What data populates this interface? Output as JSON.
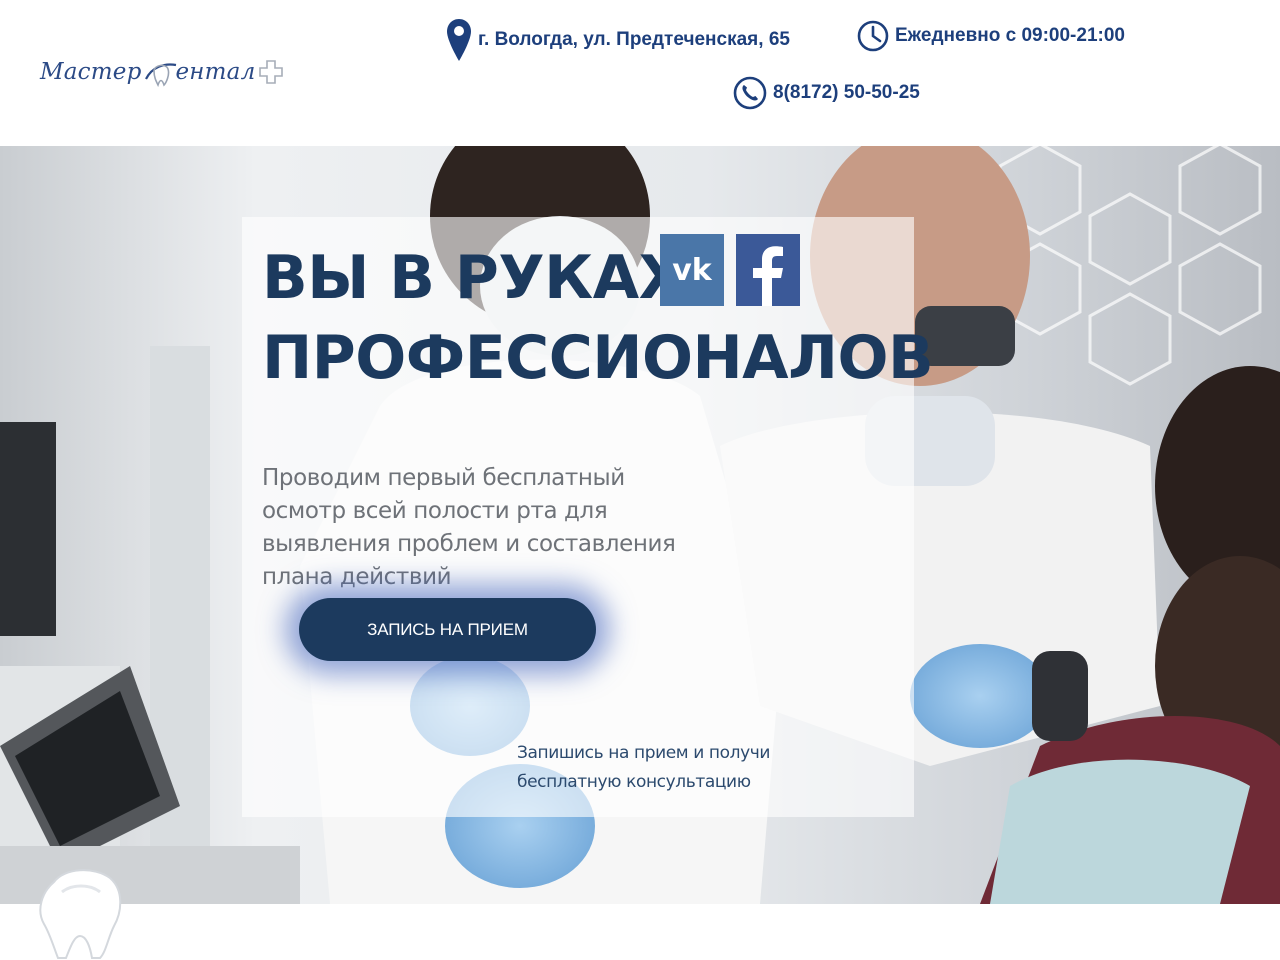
{
  "header": {
    "logo": {
      "word1": "Мастер",
      "word2": "ентал"
    },
    "address": "г. Вологда, ул. Предтеченская, 65",
    "hours": "Ежедневно с 09:00-21:00",
    "phone": "8(8172) 50-50-25",
    "icons": {
      "address": "map-pin-icon",
      "hours": "clock-icon",
      "phone": "phone-icon"
    }
  },
  "hero": {
    "title_line1": "ВЫ В РУКАХ",
    "title_line2": "ПРОФЕССИОНАЛОВ",
    "subtitle": "Проводим первый бесплатный осмотр всей полости рта для выявления проблем и составления плана действий",
    "cta_label": "ЗАПИСЬ НА ПРИЕМ",
    "note": "Запишись на прием и получи бесплатную консультацию",
    "social": [
      "vk-icon",
      "facebook-icon"
    ]
  },
  "colors": {
    "brand_blue": "#1d3f7c",
    "title_navy": "#1c3a5e",
    "social_vk": "#4a76a8",
    "social_fb": "#3b5998"
  }
}
